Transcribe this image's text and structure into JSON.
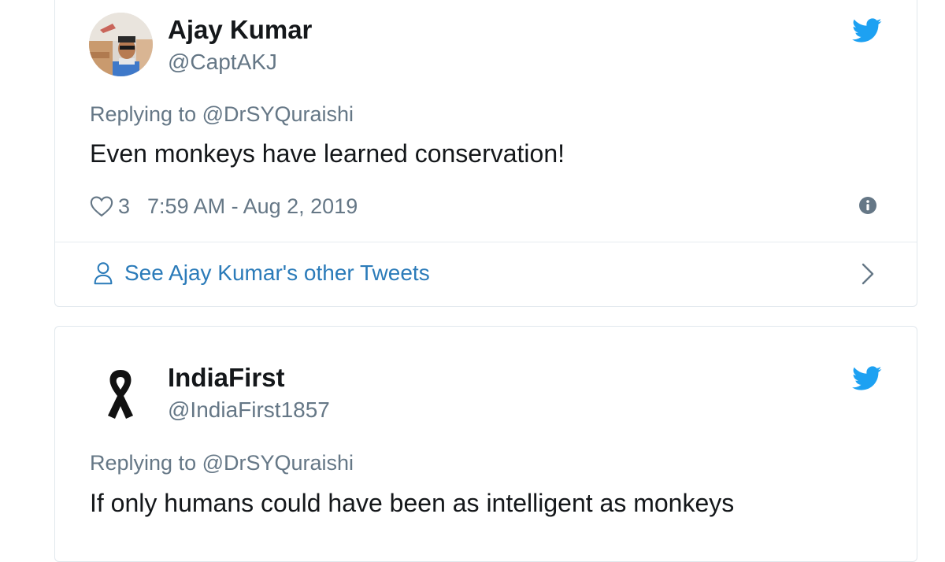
{
  "tweets": [
    {
      "display_name": "Ajay Kumar",
      "handle": "@CaptAKJ",
      "replying_to": "Replying to @DrSYQuraishi",
      "text": "Even monkeys have learned conservation!",
      "likes": "3",
      "timestamp": "7:59 AM - Aug 2, 2019",
      "other_tweets_link": "See Ajay Kumar's other Tweets",
      "avatar_icon": "profile-photo"
    },
    {
      "display_name": "IndiaFirst",
      "handle": "@IndiaFirst1857",
      "replying_to": "Replying to @DrSYQuraishi",
      "text": "If only humans could have been as intelligent as monkeys",
      "avatar_icon": "black-ribbon-icon"
    }
  ],
  "colors": {
    "twitter_blue": "#1da1f2",
    "link_blue": "#2b7bb9",
    "secondary_text": "#657786",
    "primary_text": "#14171a",
    "border": "#e1e8ed"
  }
}
